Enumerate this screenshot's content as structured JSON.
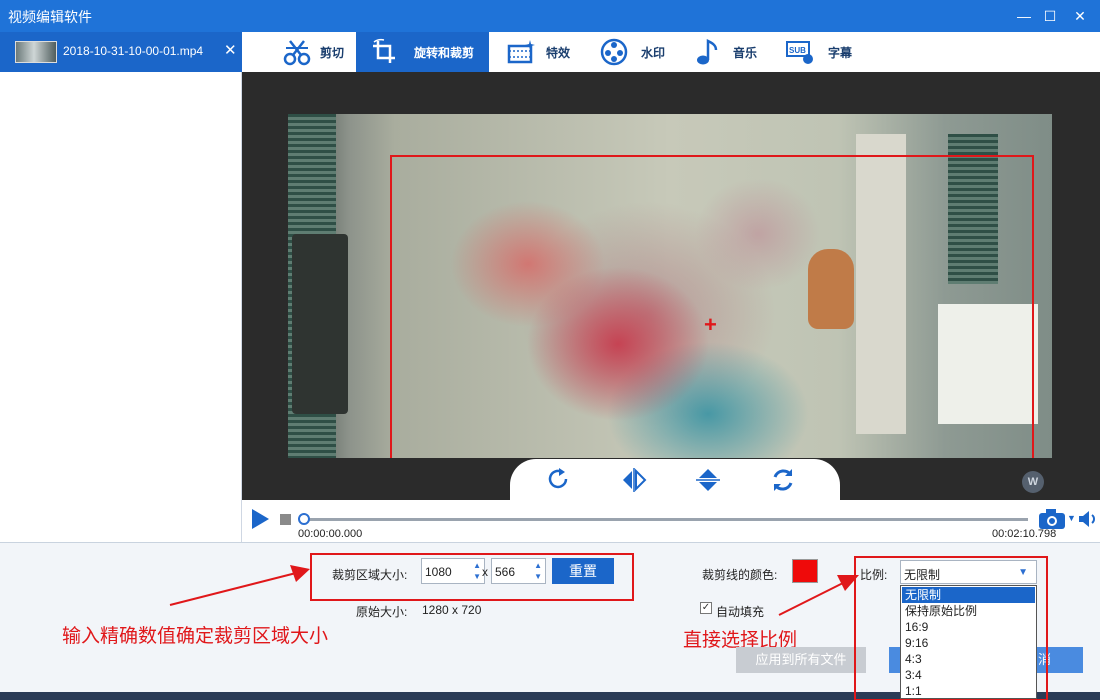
{
  "window": {
    "title": "视频编辑软件",
    "min_glyph": "—",
    "max_glyph": "☐",
    "close_glyph": "✕"
  },
  "file_tab": {
    "name": "2018-10-31-10-00-01.mp4",
    "close_glyph": "✕"
  },
  "tool_tabs": [
    {
      "label": "剪切",
      "icon": "scissors-icon"
    },
    {
      "label": "旋转和裁剪",
      "icon": "crop-icon",
      "active": true
    },
    {
      "label": "特效",
      "icon": "effects-icon"
    },
    {
      "label": "水印",
      "icon": "watermark-icon"
    },
    {
      "label": "音乐",
      "icon": "music-note-icon"
    },
    {
      "label": "字幕",
      "icon": "subtitle-icon"
    }
  ],
  "preview": {
    "watermark_text": "W",
    "chevron": "⌄"
  },
  "playback": {
    "current_time": "00:00:00.000",
    "duration": "00:02:10.798",
    "progress": 0
  },
  "crop": {
    "area_label": "裁剪区域大小:",
    "width": "1080",
    "x_sep": "x",
    "height": "566",
    "reset_label": "重置",
    "original_label": "原始大小:",
    "original_value": "1280 x 720",
    "line_color_label": "裁剪线的颜色:",
    "line_color": "#ef0a0a",
    "auto_fill_label": "自动填充",
    "auto_fill_checked": true,
    "ratio_label": "比例:",
    "ratio_selected": "无限制",
    "ratio_options": [
      "无限制",
      "保持原始比例",
      "16:9",
      "9:16",
      "4:3",
      "3:4",
      "1:1"
    ]
  },
  "annotations": {
    "left": "输入精确数值确定裁剪区域大小",
    "right": "直接选择比例"
  },
  "buttons": {
    "apply_all": "应用到所有文件",
    "ok_partial": "消"
  },
  "colors": {
    "accent": "#1b66c9",
    "titlebar": "#1f73d8",
    "annotation_red": "#e0171a"
  }
}
